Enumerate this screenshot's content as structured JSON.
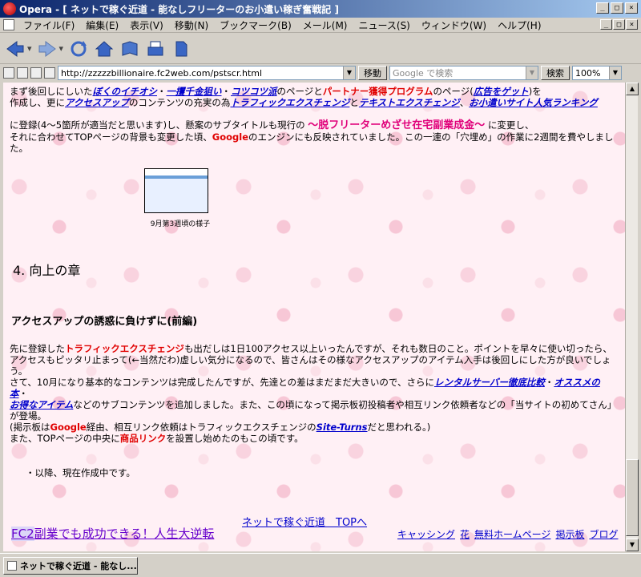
{
  "window": {
    "title": "Opera - [ ネットで稼ぐ近道 - 能なしフリーターのお小遣い稼ぎ奮戦記 ]",
    "minimize": "_",
    "maximize": "□",
    "close": "×"
  },
  "menu": [
    "ファイル(F)",
    "編集(E)",
    "表示(V)",
    "移動(N)",
    "ブックマーク(B)",
    "メール(M)",
    "ニュース(S)",
    "ウィンドウ(W)",
    "ヘルプ(H)"
  ],
  "address": {
    "url": "http://zzzzzbillionaire.fc2web.com/pstscr.html",
    "go_label": "移動",
    "search_placeholder": "Google で検索",
    "search_label": "検索",
    "zoom": "100%"
  },
  "content": {
    "p1_a": "まず後回しにしいた",
    "p1_link1": "ぼくのイチオシ",
    "p1_sep1": "・",
    "p1_link2": "一攫千金狙い",
    "p1_sep2": "・",
    "p1_link3": "コツコツ派",
    "p1_b": "のページと",
    "p1_red1": "パートナー獲得プログラム",
    "p1_c": "のページ(",
    "p1_link4": "広告をゲット",
    "p1_d": ")を",
    "p2_a": "作成し、更に",
    "p2_link1": "アクセスアップ",
    "p2_b": "のコンテンツの充実の為",
    "p2_link2": "トラフィックエクスチェンジ",
    "p2_c": "と",
    "p2_link3": "テキストエクスチェンジ",
    "p2_d": "、",
    "p2_link4": "お小遣いサイト人気ランキング",
    "p3_a": "に登録(4〜5箇所が適当だと思います)し、懸案のサブタイトルも現行の",
    "p3_magenta": "〜脱フリーターめざせ在宅副業成金〜",
    "p3_b": "に変更し、",
    "p4_a": "それに合わせてTOPページの背景も変更した頃、",
    "p4_red": "Google",
    "p4_b": "のエンジンにも反映されていました。この一連の「穴埋め」の作業に2週間を費やしました。",
    "thumb_caption": "9月第3週頃の様子",
    "chapter": "4. 向上の章",
    "section": "アクセスアップの誘惑に負けずに(前編)",
    "s1_a": "先に登録した",
    "s1_red": "トラフィックエクスチェンジ",
    "s1_b": "も出だしは1日100アクセス以上いったんですが、それも数日のこと。ポイントを早々に使い切ったら、",
    "s2": "アクセスもピッタリ止まって(←当然だわ)虚しい気分になるので、皆さんはその様なアクセスアップのアイテム入手は後回しにした方が良いでしょう。",
    "s3_a": "さて、10月になり基本的なコンテンツは完成したんですが、先達との差はまだまだ大きいので、さらに",
    "s3_link1": "レンタルサーバー徹底比較",
    "s3_sep": "・",
    "s3_link2": "オススメの本",
    "s3_sep2": "・",
    "s4_link": "お得なアイテム",
    "s4_a": "などのサブコンテンツを追加しました。また、この頃になって掲示板初投稿者や相互リンク依頼者などの「当サイトの初めてさん」が登場。",
    "s5_a": "(掲示板は",
    "s5_red": "Google",
    "s5_b": "経由、相互リンク依頼はトラフィックエクスチェンジの",
    "s5_link": "Site-Turns",
    "s5_c": "だと思われる。)",
    "s6_a": "また、TOPページの中央に",
    "s6_red": "商品リンク",
    "s6_b": "を設置し始めたのもこの頃です。",
    "s7": "・以降、現在作成中です。",
    "footer_top": "ネットで稼ぐ近道　TOPへ",
    "footer_fc2": "FC2",
    "footer_left": "副業でも成功できる！人生大逆転",
    "footer_links": [
      "キャッシング",
      "花",
      "無料ホームページ",
      "掲示板",
      "ブログ"
    ]
  },
  "status": {
    "tab_label": "ネットで稼ぐ近道 - 能なし..."
  }
}
